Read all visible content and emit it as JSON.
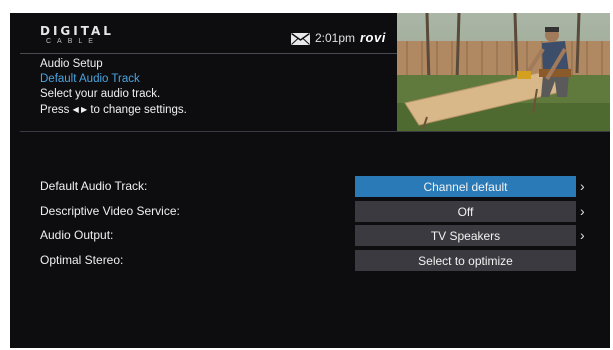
{
  "header": {
    "logo_main": "DIGITAL",
    "logo_sub": "CABLE",
    "time": "2:01pm",
    "brand": "rovi"
  },
  "info": {
    "title": "Audio Setup",
    "subtitle": "Default Audio Track",
    "line1": "Select your audio track.",
    "line2_prefix": "Press",
    "line2_arrows": "◀ ▶",
    "line2_suffix": "to change settings."
  },
  "settings": [
    {
      "label": "Default Audio Track:",
      "value": "Channel default",
      "selected": true,
      "has_arrow": true
    },
    {
      "label": "Descriptive Video Service:",
      "value": "Off",
      "selected": false,
      "has_arrow": true
    },
    {
      "label": "Audio Output:",
      "value": "TV Speakers",
      "selected": false,
      "has_arrow": true
    },
    {
      "label": "Optimal Stereo:",
      "value": "Select to optimize",
      "selected": false,
      "has_arrow": false
    }
  ],
  "chevron_glyph": "›",
  "icons": {
    "mail": "mail-icon",
    "chevron": "chevron-right-icon"
  },
  "colors": {
    "background": "#0d0d10",
    "accent": "#2a7ab8",
    "subtitle": "#4aa3df",
    "value_box": "#3a3a40"
  }
}
